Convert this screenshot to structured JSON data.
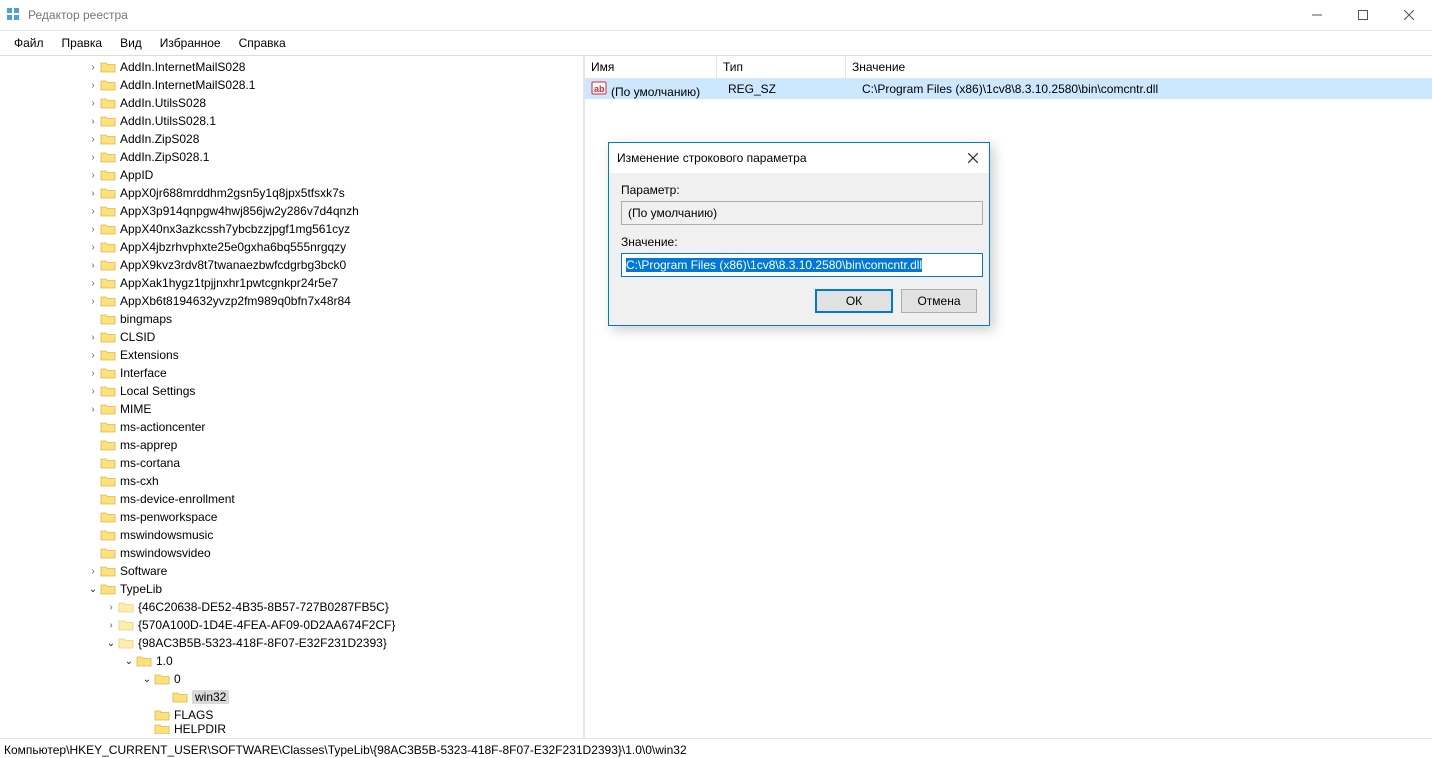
{
  "window": {
    "title": "Редактор реестра",
    "menus": [
      "Файл",
      "Правка",
      "Вид",
      "Избранное",
      "Справка"
    ]
  },
  "tree": {
    "indent_base": 86,
    "items": [
      {
        "arrow": ">",
        "label": "AddIn.InternetMailS028",
        "depth": 0
      },
      {
        "arrow": ">",
        "label": "AddIn.InternetMailS028.1",
        "depth": 0
      },
      {
        "arrow": ">",
        "label": "AddIn.UtilsS028",
        "depth": 0
      },
      {
        "arrow": ">",
        "label": "AddIn.UtilsS028.1",
        "depth": 0
      },
      {
        "arrow": ">",
        "label": "AddIn.ZipS028",
        "depth": 0
      },
      {
        "arrow": ">",
        "label": "AddIn.ZipS028.1",
        "depth": 0
      },
      {
        "arrow": ">",
        "label": "AppID",
        "depth": 0
      },
      {
        "arrow": ">",
        "label": "AppX0jr688mrddhm2gsn5y1q8jpx5tfsxk7s",
        "depth": 0
      },
      {
        "arrow": ">",
        "label": "AppX3p914qnpgw4hwj856jw2y286v7d4qnzh",
        "depth": 0
      },
      {
        "arrow": ">",
        "label": "AppX40nx3azkcssh7ybcbzzjpgf1mg561cyz",
        "depth": 0
      },
      {
        "arrow": ">",
        "label": "AppX4jbzrhvphxte25e0gxha6bq555nrgqzy",
        "depth": 0
      },
      {
        "arrow": ">",
        "label": "AppX9kvz3rdv8t7twanaezbwfcdgrbg3bck0",
        "depth": 0
      },
      {
        "arrow": ">",
        "label": "AppXak1hygz1tpjjnxhr1pwtcgnkpr24r5e7",
        "depth": 0
      },
      {
        "arrow": ">",
        "label": "AppXb6t8194632yvzp2fm989q0bfn7x48r84",
        "depth": 0
      },
      {
        "arrow": "",
        "label": "bingmaps",
        "depth": 0
      },
      {
        "arrow": ">",
        "label": "CLSID",
        "depth": 0
      },
      {
        "arrow": ">",
        "label": "Extensions",
        "depth": 0
      },
      {
        "arrow": ">",
        "label": "Interface",
        "depth": 0
      },
      {
        "arrow": ">",
        "label": "Local Settings",
        "depth": 0
      },
      {
        "arrow": ">",
        "label": "MIME",
        "depth": 0
      },
      {
        "arrow": "",
        "label": "ms-actioncenter",
        "depth": 0
      },
      {
        "arrow": "",
        "label": "ms-apprep",
        "depth": 0
      },
      {
        "arrow": "",
        "label": "ms-cortana",
        "depth": 0
      },
      {
        "arrow": "",
        "label": "ms-cxh",
        "depth": 0
      },
      {
        "arrow": "",
        "label": "ms-device-enrollment",
        "depth": 0
      },
      {
        "arrow": "",
        "label": "ms-penworkspace",
        "depth": 0
      },
      {
        "arrow": "",
        "label": "mswindowsmusic",
        "depth": 0
      },
      {
        "arrow": "",
        "label": "mswindowsvideo",
        "depth": 0
      },
      {
        "arrow": ">",
        "label": "Software",
        "depth": 0
      },
      {
        "arrow": "v",
        "label": "TypeLib",
        "depth": 0
      },
      {
        "arrow": ">",
        "label": "{46C20638-DE52-4B35-8B57-727B0287FB5C}",
        "depth": 1,
        "dim": true
      },
      {
        "arrow": ">",
        "label": "{570A100D-1D4E-4FEA-AF09-0D2AA674F2CF}",
        "depth": 1,
        "dim": true
      },
      {
        "arrow": "v",
        "label": "{98AC3B5B-5323-418F-8F07-E32F231D2393}",
        "depth": 1,
        "dim": true
      },
      {
        "arrow": "v",
        "label": "1.0",
        "depth": 2
      },
      {
        "arrow": "v",
        "label": "0",
        "depth": 3
      },
      {
        "arrow": "",
        "label": "win32",
        "depth": 4,
        "selected": true
      },
      {
        "arrow": "",
        "label": "FLAGS",
        "depth": 3
      },
      {
        "arrow": "",
        "label": "HELPDIR",
        "depth": 3,
        "halfcut": true
      }
    ]
  },
  "list": {
    "headers": {
      "name": "Имя",
      "type": "Тип",
      "value": "Значение"
    },
    "col_w": {
      "name": 119,
      "type": 116,
      "value": 370
    },
    "row": {
      "name": "(По умолчанию)",
      "type": "REG_SZ",
      "value": "C:\\Program Files (x86)\\1cv8\\8.3.10.2580\\bin\\comcntr.dll"
    }
  },
  "status": {
    "path": "Компьютер\\HKEY_CURRENT_USER\\SOFTWARE\\Classes\\TypeLib\\{98AC3B5B-5323-418F-8F07-E32F231D2393}\\1.0\\0\\win32"
  },
  "dialog": {
    "title": "Изменение строкового параметра",
    "param_label": "Параметр:",
    "param_value": "(По умолчанию)",
    "value_label": "Значение:",
    "value_value": "C:\\Program Files (x86)\\1cv8\\8.3.10.2580\\bin\\comcntr.dll",
    "ok": "ОК",
    "cancel": "Отмена"
  }
}
